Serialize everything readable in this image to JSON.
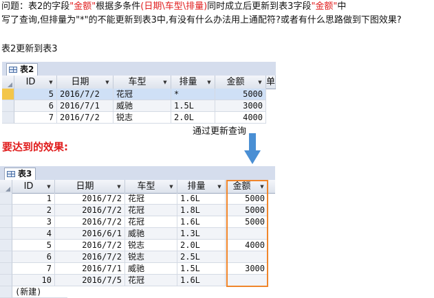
{
  "question": {
    "line1": [
      {
        "text": "问题：表2的字段",
        "red": false
      },
      {
        "text": "\"金额\"",
        "red": true
      },
      {
        "text": "根据多条件",
        "red": false
      },
      {
        "text": "(日期\\车型\\排量)",
        "red": true
      },
      {
        "text": "同时成立后更新到表3字段",
        "red": false
      },
      {
        "text": "\"金额\"",
        "red": true
      },
      {
        "text": "中",
        "red": false
      }
    ],
    "line2": "写了查询,但排量为\"*\"的不能更新到表3中,有没有什么办法用上通配符?或者有什么思路做到下图效果?",
    "line3": "表2更新到表3"
  },
  "annotation_query": "通过更新查询",
  "result_heading": "要达到的效果:",
  "table2": {
    "tab": "表2",
    "columns": [
      "ID",
      "日期",
      "车型",
      "排量",
      "金额",
      "单"
    ],
    "rows": [
      {
        "id": "5",
        "date": "2016/7/2",
        "model": "花冠",
        "disp": "*",
        "amount": "5000",
        "selected": true
      },
      {
        "id": "6",
        "date": "2016/7/1",
        "model": "威驰",
        "disp": "1.5L",
        "amount": "3000"
      },
      {
        "id": "7",
        "date": "2016/7/2",
        "model": "锐志",
        "disp": "2.0L",
        "amount": "4000"
      }
    ]
  },
  "table3": {
    "tab": "表3",
    "columns": [
      "ID",
      "日期",
      "车型",
      "排量",
      "金额"
    ],
    "rows": [
      {
        "id": "1",
        "date": "2016/7/2",
        "model": "花冠",
        "disp": "1.6L",
        "amount": "5000"
      },
      {
        "id": "2",
        "date": "2016/7/2",
        "model": "花冠",
        "disp": "1.8L",
        "amount": "5000"
      },
      {
        "id": "3",
        "date": "2016/7/2",
        "model": "花冠",
        "disp": "1.6L",
        "amount": "5000"
      },
      {
        "id": "4",
        "date": "2016/6/1",
        "model": "威驰",
        "disp": "1.3L",
        "amount": ""
      },
      {
        "id": "5",
        "date": "2016/7/2",
        "model": "锐志",
        "disp": "2.0L",
        "amount": "4000"
      },
      {
        "id": "6",
        "date": "2016/7/2",
        "model": "锐志",
        "disp": "2.5L",
        "amount": ""
      },
      {
        "id": "7",
        "date": "2016/7/1",
        "model": "威驰",
        "disp": "1.5L",
        "amount": "3000"
      },
      {
        "id": "10",
        "date": "2016/7/5",
        "model": "花冠",
        "disp": "1.6L",
        "amount": ""
      }
    ],
    "new_row": "(新建)"
  },
  "colors": {
    "red": "#e01b1b",
    "arrow": "#4a8fd4",
    "highlight_box": "#f0852a",
    "selected_row": "#cfe0f6"
  }
}
